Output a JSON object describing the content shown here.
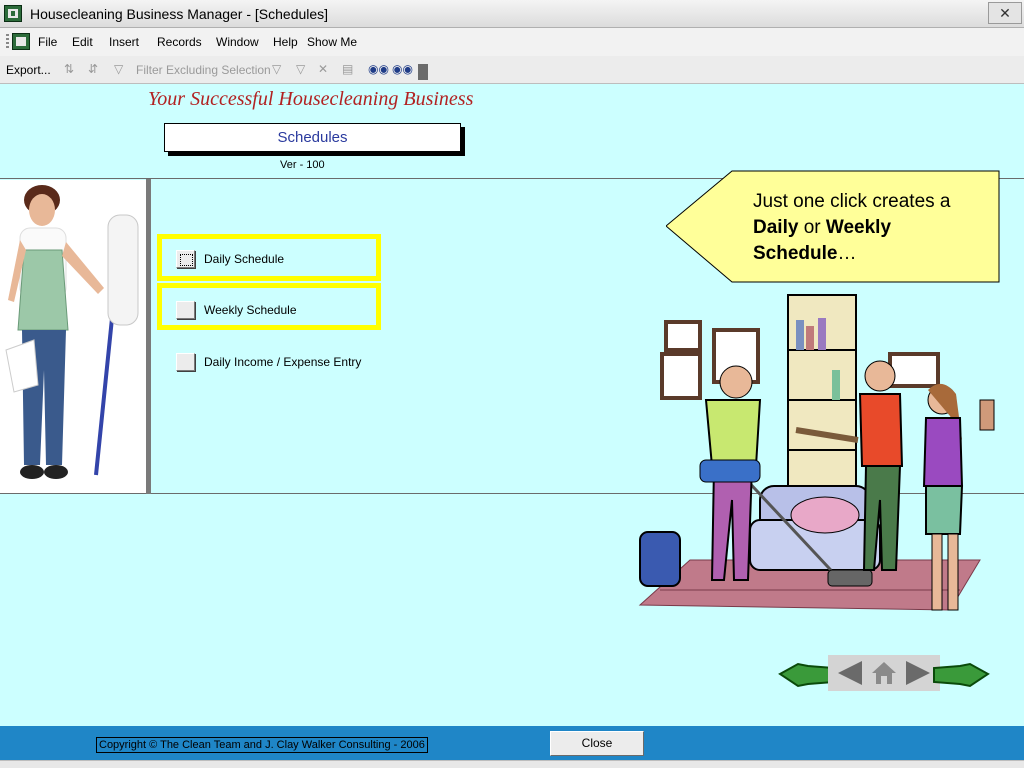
{
  "window": {
    "title": "Housecleaning Business Manager - [Schedules]"
  },
  "menu": {
    "items": [
      "File",
      "Edit",
      "Insert",
      "Records",
      "Window",
      "Help",
      "Show Me"
    ]
  },
  "toolbar": {
    "export_label": "Export...",
    "filter_label": "Filter Excluding Selection"
  },
  "header": {
    "brand": "Your Successful Housecleaning Business",
    "form_title": "Schedules",
    "version": "Ver - 100"
  },
  "buttons": {
    "daily": "Daily Schedule",
    "weekly": "Weekly Schedule",
    "income": "Daily Income / Expense Entry"
  },
  "callout": {
    "pre": "Just one click creates a ",
    "daily": "Daily",
    "mid": " or ",
    "weekly": "Weekly Schedule",
    "post": "…"
  },
  "footer": {
    "copyright": "Copyright © The Clean Team and J. Clay Walker Consulting - 2006",
    "close_label": "Close"
  },
  "colors": {
    "background": "#ccffff",
    "highlight": "#ffff00",
    "footer": "#1f86c7",
    "brand": "#b22222",
    "callout": "#ffff99"
  }
}
